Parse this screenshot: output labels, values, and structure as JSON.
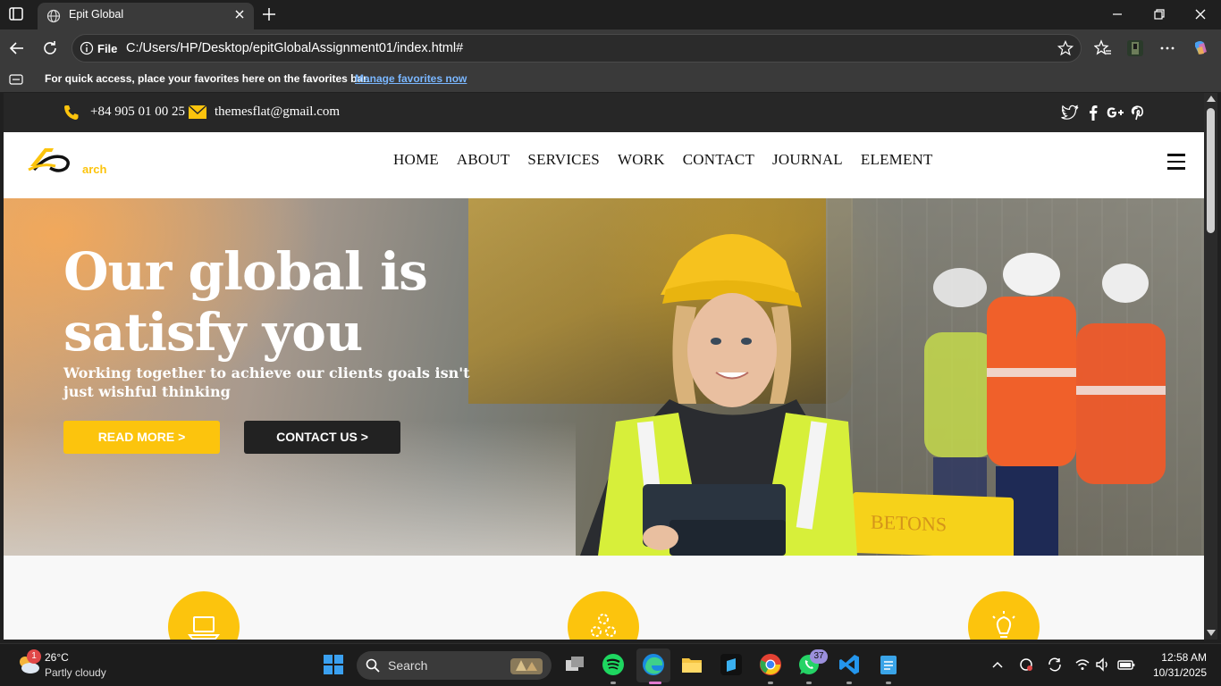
{
  "browser": {
    "tab_title": "Epit Global",
    "scheme_label": "File",
    "url": "C:/Users/HP/Desktop/epitGlobalAssignment01/index.html#",
    "favorites_message": "For quick access, place your favorites here on the favorites bar.",
    "favorites_link": "Manage favorites now"
  },
  "site": {
    "topbar": {
      "phone": "+84 905 01 00 25",
      "email": "themesflat@gmail.com",
      "social": [
        "twitter-icon",
        "facebook-icon",
        "google-plus-icon",
        "pinterest-icon"
      ]
    },
    "logo_text": "arch",
    "nav": [
      "HOME",
      "ABOUT",
      "SERVICES",
      "WORK",
      "CONTACT",
      "JOURNAL",
      "ELEMENT"
    ],
    "hero": {
      "title": "Our global is satisfy you",
      "subtitle": "Working together to achieve our clients goals isn't just wishful thinking",
      "read_more": "READ MORE >",
      "contact_us": "CONTACT US >"
    },
    "features": [
      "laptop-icon",
      "gears-icon",
      "lightbulb-icon"
    ],
    "accent_color": "#fcc40d",
    "dark_color": "#222222"
  },
  "taskbar": {
    "weather_badge": "1",
    "temperature": "26°C",
    "weather": "Partly cloudy",
    "search_label": "Search",
    "whatsapp_badge": "37",
    "time": "12:58 AM",
    "date": "10/31/2025"
  }
}
